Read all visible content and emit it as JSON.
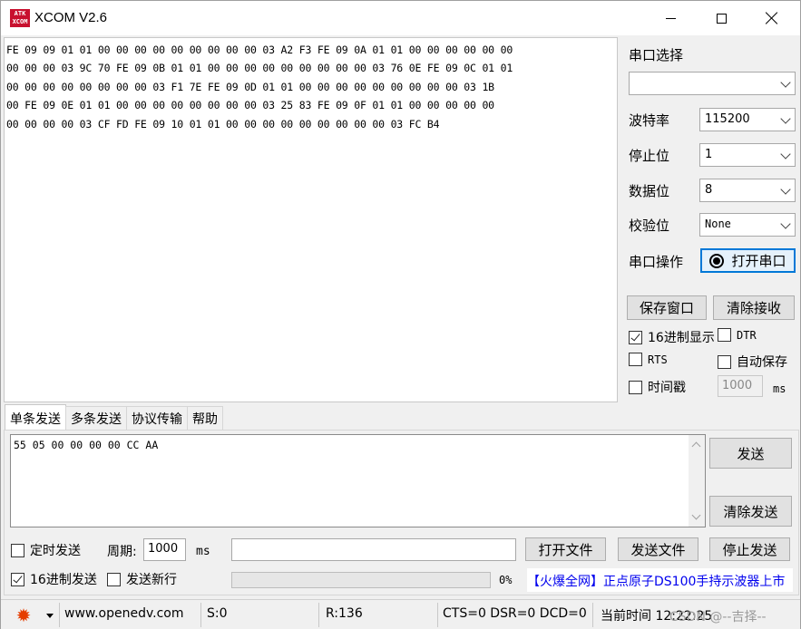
{
  "window": {
    "logo_text_top": "ATK",
    "logo_text_bottom": "XCOM",
    "title": "XCOM V2.6"
  },
  "receive": {
    "lines": [
      "FE 09 09 01 01 00 00 00 00 00 00 00 00 00 03 A2 F3 FE 09 0A 01 01 00 00 00 00 00 00",
      "00 00 00 03 9C 70 FE 09 0B 01 01 00 00 00 00 00 00 00 00 00 03 76 0E FE 09 0C 01 01",
      "00 00 00 00 00 00 00 00 03 F1 7E FE 09 0D 01 01 00 00 00 00 00 00 00 00 00 03 1B",
      "00 FE 09 0E 01 01 00 00 00 00 00 00 00 00 03 25 83 FE 09 0F 01 01 00 00 00 00 00",
      "00 00 00 00 03 CF FD FE 09 10 01 01 00 00 00 00 00 00 00 00 00 03 FC B4"
    ]
  },
  "right_panel": {
    "port_select_label": "串口选择",
    "port_value": "",
    "baud_label": "波特率",
    "baud_value": "115200",
    "stop_label": "停止位",
    "stop_value": "1",
    "data_label": "数据位",
    "data_value": "8",
    "parity_label": "校验位",
    "parity_value": "None",
    "port_op_label": "串口操作",
    "open_port_button": "打开串口",
    "save_window_button": "保存窗口",
    "clear_receive_button": "清除接收",
    "hex_display_label": "16进制显示",
    "hex_display_checked": true,
    "dtr_label": "DTR",
    "dtr_checked": false,
    "rts_label": "RTS",
    "rts_checked": false,
    "auto_save_label": "自动保存",
    "auto_save_checked": false,
    "timestamp_label": "时间戳",
    "timestamp_checked": false,
    "timestamp_value": "1000",
    "timestamp_unit": "ms"
  },
  "tabs": [
    "单条发送",
    "多条发送",
    "协议传输",
    "帮助"
  ],
  "send": {
    "text": "55 05 00 00 00 00 CC AA",
    "send_button": "发送",
    "clear_send_button": "清除发送",
    "timed_send_label": "定时发送",
    "timed_send_checked": false,
    "period_label": "周期:",
    "period_value": "1000",
    "period_unit": "ms",
    "file_path": "",
    "open_file_button": "打开文件",
    "send_file_button": "发送文件",
    "stop_send_button": "停止发送",
    "hex_send_label": "16进制发送",
    "hex_send_checked": true,
    "newline_label": "发送新行",
    "newline_checked": false,
    "progress_percent": 0,
    "progress_text": "0%",
    "ad_text": "【火爆全网】正点原子DS100手持示波器上市"
  },
  "status_bar": {
    "website": "www.openedv.com",
    "sent": "S:0",
    "received": "R:136",
    "lines_status": "CTS=0 DSR=0 DCD=0",
    "time_label": "当前时间 12:22:25",
    "watermark": "CSDN @--吉择--"
  },
  "colors": {
    "accent": "#0078d7",
    "gear": "#e53d00",
    "ad": "#0000ee",
    "logo": "#c8102e"
  }
}
